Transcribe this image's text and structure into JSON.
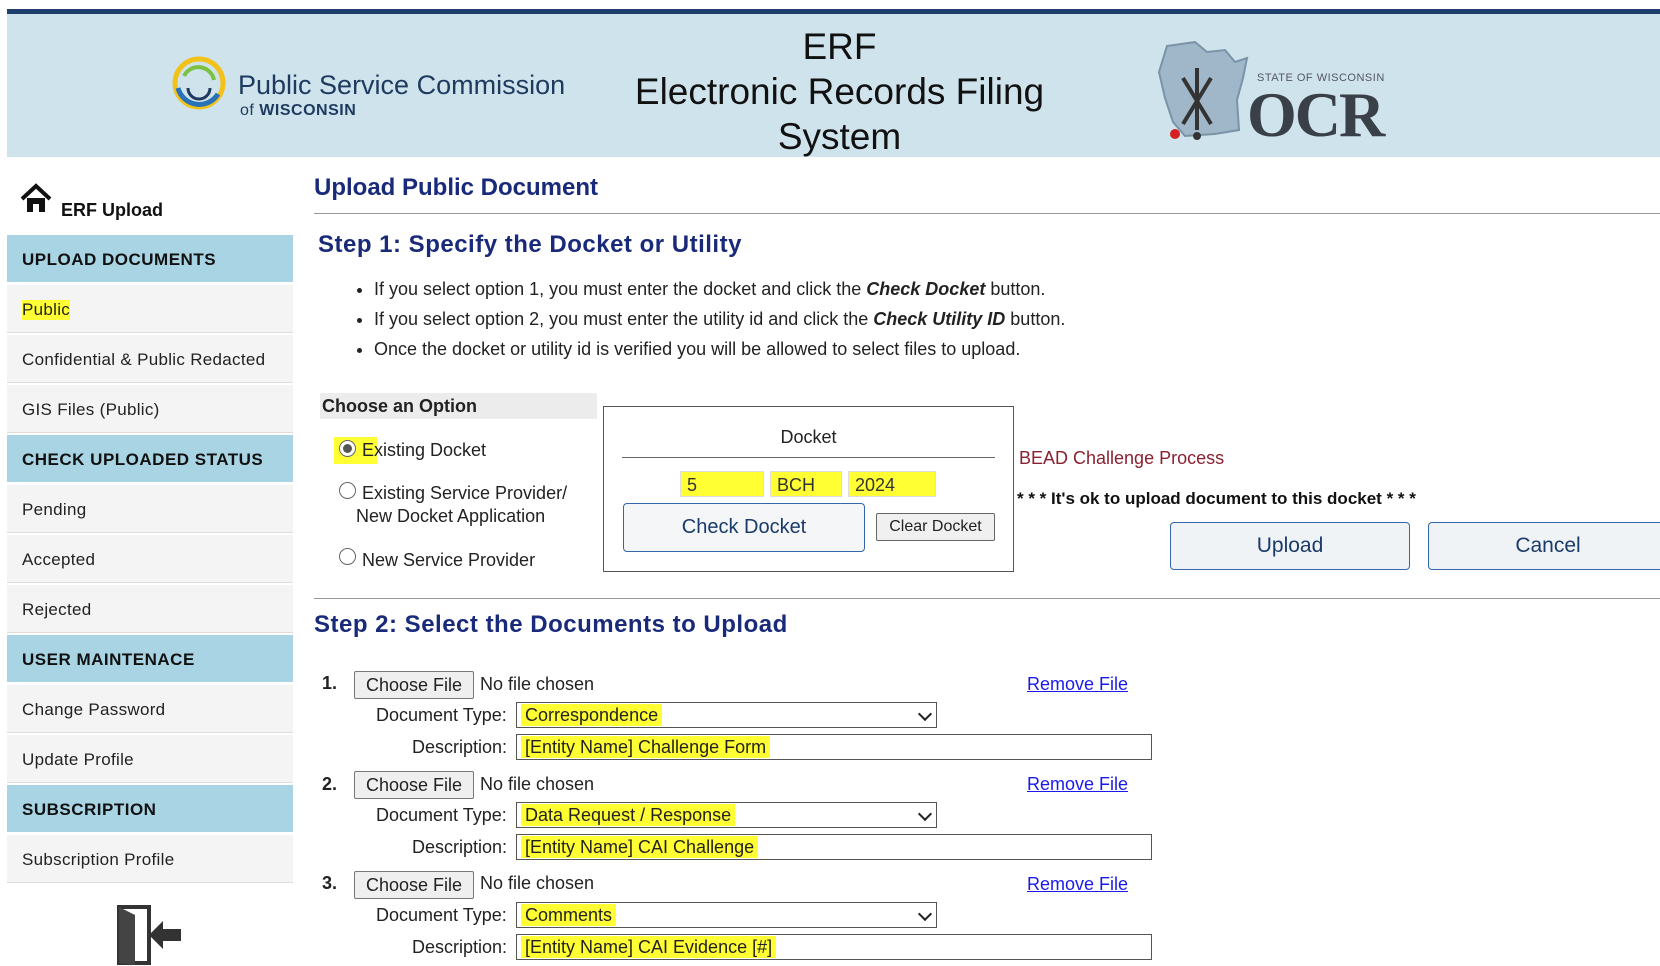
{
  "header": {
    "org_name": "Public Service Commission",
    "org_of": "of",
    "org_state": "WISCONSIN",
    "title_line1": "ERF",
    "title_line2": "Electronic Records Filing",
    "title_line3": "System",
    "ocr_small": "STATE OF WISCONSIN",
    "ocr_big": "OCR"
  },
  "sidebar": {
    "home_label": "ERF Upload",
    "sections": [
      {
        "title": "UPLOAD DOCUMENTS",
        "items": [
          "Public",
          "Confidential & Public Redacted",
          "GIS Files (Public)"
        ]
      },
      {
        "title": "CHECK UPLOADED STATUS",
        "items": [
          "Pending",
          "Accepted",
          "Rejected"
        ]
      },
      {
        "title": "USER MAINTENACE",
        "items": [
          "Change Password",
          "Update Profile"
        ]
      },
      {
        "title": "SUBSCRIPTION",
        "items": [
          "Subscription Profile"
        ]
      }
    ]
  },
  "main": {
    "title": "Upload Public Document",
    "step1_title": "Step 1: Specify the Docket or Utility",
    "bullets": [
      {
        "pre": "If you select option 1, you must enter the docket and click the ",
        "em": "Check Docket",
        "post": " button."
      },
      {
        "pre": "If you select option 2, you must enter the utility id and click the ",
        "em": "Check Utility ID",
        "post": " button."
      },
      {
        "pre": "Once the docket or utility id is verified you will be allowed to select files to upload.",
        "em": "",
        "post": ""
      }
    ],
    "option_heading": "Choose an Option",
    "options": [
      "Existing Docket",
      "Existing Service Provider/",
      "New Docket Application",
      "New Service Provider"
    ],
    "docket": {
      "label": "Docket",
      "part1": "5",
      "part2": "BCH",
      "part3": "2024",
      "check_button": "Check Docket",
      "clear_button": "Clear Docket"
    },
    "bead_text": "BEAD Challenge Process",
    "ok_message": "* * * It's ok to upload document to this docket * * *",
    "upload_button": "Upload",
    "cancel_button": "Cancel",
    "step2_title": "Step 2: Select the Documents to Upload",
    "files": [
      {
        "num": "1.",
        "choose": "Choose File",
        "nofile": "No file chosen",
        "remove": "Remove File",
        "type_label": "Document Type:",
        "type": "Correspondence",
        "desc_label": "Description:",
        "desc": "[Entity Name] Challenge Form"
      },
      {
        "num": "2.",
        "choose": "Choose File",
        "nofile": "No file chosen",
        "remove": "Remove File",
        "type_label": "Document Type:",
        "type": "Data Request / Response",
        "desc_label": "Description:",
        "desc": "[Entity Name] CAI Challenge"
      },
      {
        "num": "3.",
        "choose": "Choose File",
        "nofile": "No file chosen",
        "remove": "Remove File",
        "type_label": "Document Type:",
        "type": "Comments",
        "desc_label": "Description:",
        "desc": "[Entity Name] CAI Evidence [#]"
      }
    ]
  },
  "colors": {
    "header_bg": "#cfe3ec",
    "section_bg": "#a8d4e4",
    "heading_blue": "#1a2a7a",
    "highlight": "#ffff33",
    "bead_red": "#8a2030"
  }
}
